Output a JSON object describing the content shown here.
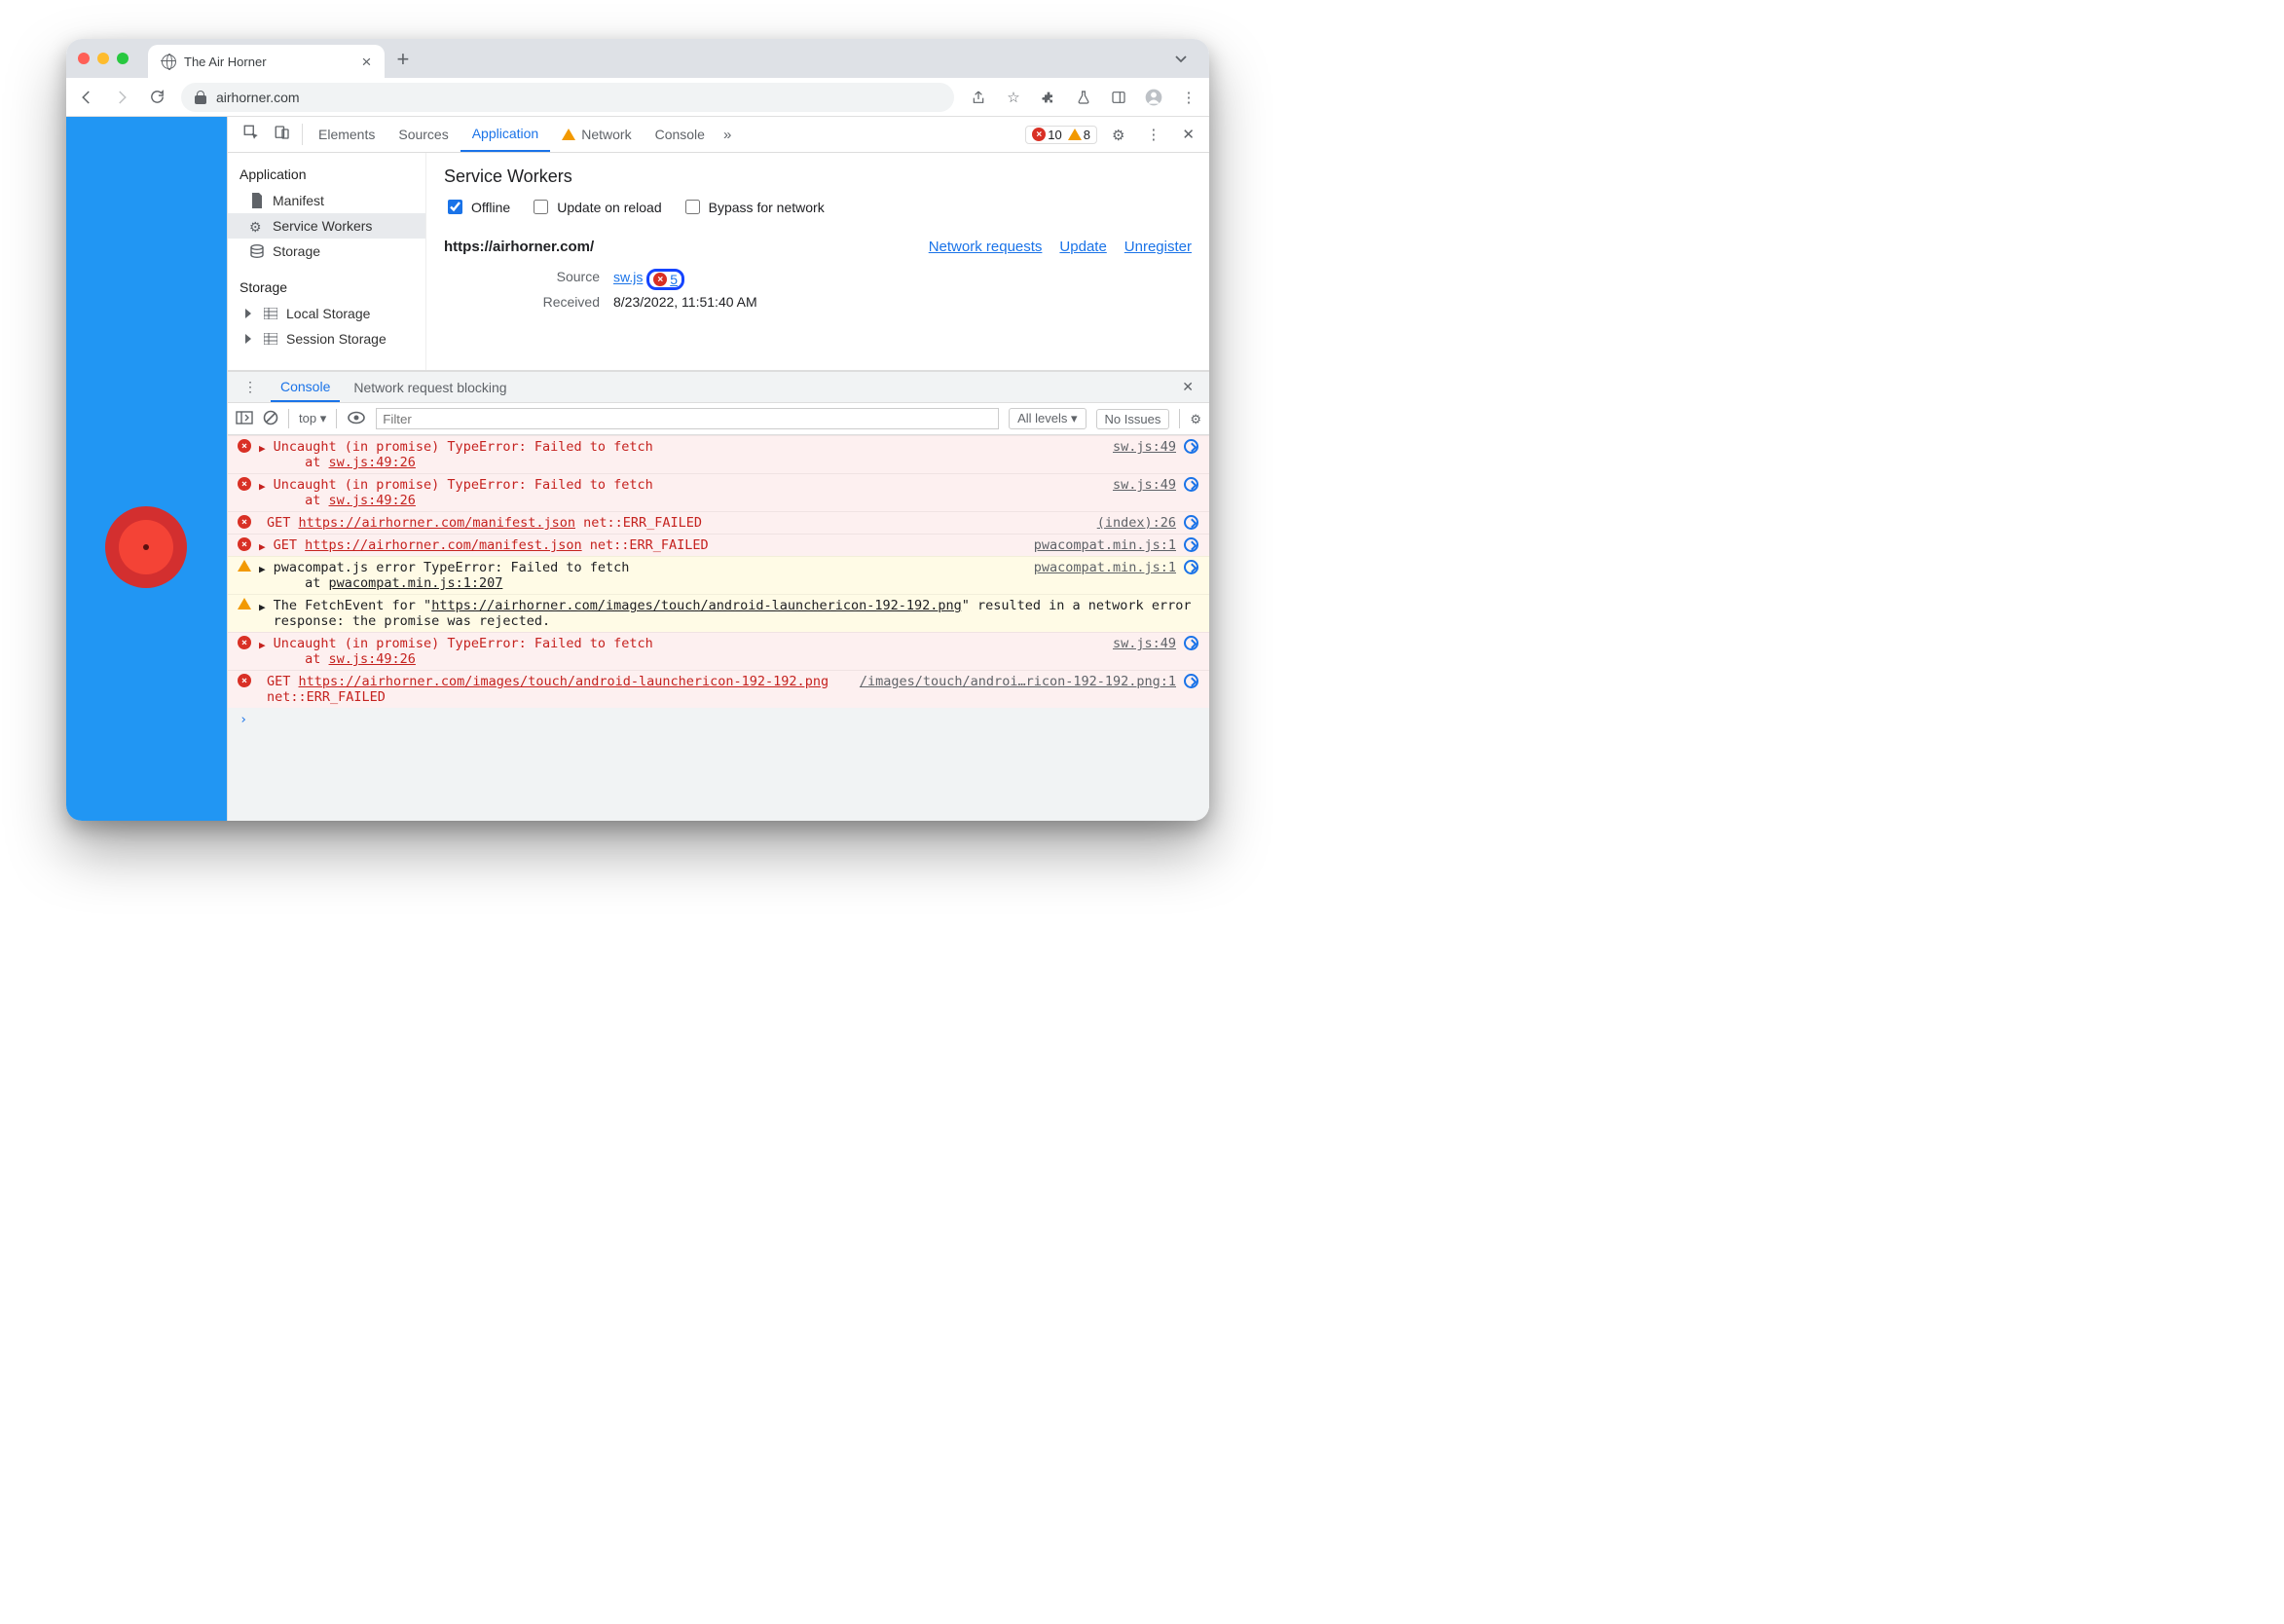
{
  "browser": {
    "tab_title": "The Air Horner",
    "url": "airhorner.com"
  },
  "devtools": {
    "tabs": {
      "elements": "Elements",
      "sources": "Sources",
      "application": "Application",
      "network": "Network",
      "console": "Console"
    },
    "counts": {
      "errors": "10",
      "warnings": "8"
    }
  },
  "sidebar": {
    "app_header": "Application",
    "manifest": "Manifest",
    "sw": "Service Workers",
    "storage": "Storage",
    "storage_header": "Storage",
    "local": "Local Storage",
    "session": "Session Storage"
  },
  "sw": {
    "title": "Service Workers",
    "offline": "Offline",
    "update": "Update on reload",
    "bypass": "Bypass for network",
    "origin": "https://airhorner.com/",
    "net_req": "Network requests",
    "update_link": "Update",
    "unregister": "Unregister",
    "source_label": "Source",
    "source_file": "sw.js",
    "err_count": "5",
    "received_label": "Received",
    "received_value": "8/23/2022, 11:51:40 AM"
  },
  "drawer": {
    "console": "Console",
    "nrb": "Network request blocking",
    "context": "top",
    "filter_ph": "Filter",
    "levels": "All levels",
    "issues": "No Issues"
  },
  "msgs": [
    {
      "type": "err",
      "expand": true,
      "text": "Uncaught (in promise) TypeError: Failed to fetch\n    at sw.js:49:26",
      "src": "sw.js:49",
      "link": "sw.js:49:26"
    },
    {
      "type": "err",
      "expand": true,
      "text": "Uncaught (in promise) TypeError: Failed to fetch\n    at sw.js:49:26",
      "src": "sw.js:49",
      "link": "sw.js:49:26"
    },
    {
      "type": "err",
      "expand": false,
      "prefix": "GET ",
      "url": "https://airhorner.com/manifest.json",
      "suffix": " net::ERR_FAILED",
      "src": "(index):26"
    },
    {
      "type": "err",
      "expand": true,
      "prefix": "GET ",
      "url": "https://airhorner.com/manifest.json",
      "suffix": " net::ERR_FAILED",
      "src": "pwacompat.min.js:1"
    },
    {
      "type": "warn",
      "expand": true,
      "text": "pwacompat.js error TypeError: Failed to fetch\n    at pwacompat.min.js:1:207",
      "src": "pwacompat.min.js:1",
      "link": "pwacompat.min.js:1:207"
    },
    {
      "type": "warn",
      "expand": true,
      "textparts": [
        "The FetchEvent for \"",
        "https://airhorner.com/images/touch/android-launchericon-192-192.png",
        "\" resulted in a network error response: the promise was rejected."
      ]
    },
    {
      "type": "err",
      "expand": true,
      "text": "Uncaught (in promise) TypeError: Failed to fetch\n    at sw.js:49:26",
      "src": "sw.js:49",
      "link": "sw.js:49:26"
    },
    {
      "type": "err",
      "expand": false,
      "prefix": "GET ",
      "url": "https://airhorner.com/images/touch/android-launchericon-192-192.png",
      "suffix": " net::ERR_FAILED",
      "src": "/images/touch/androi…ricon-192-192.png:1"
    }
  ]
}
